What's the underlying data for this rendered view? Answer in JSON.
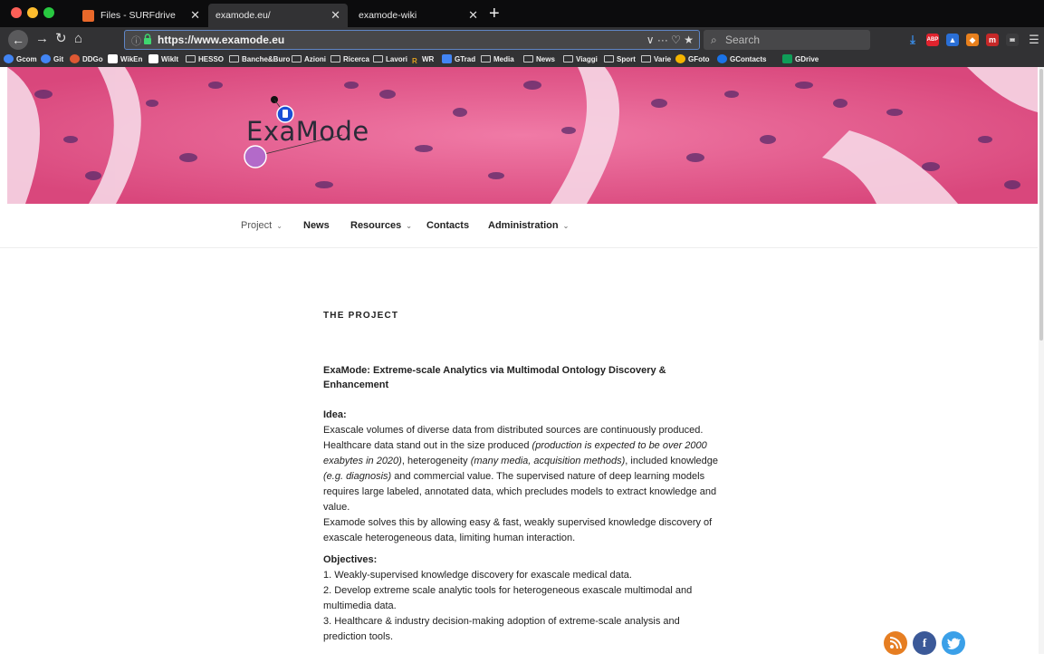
{
  "browser": {
    "tabs": [
      {
        "label": "Files - SURFdrive"
      },
      {
        "label": "examode.eu/"
      },
      {
        "label": "examode-wiki"
      }
    ],
    "url": "https://www.examode.eu",
    "url_tools": "∨  ···  ♡  ★",
    "search_placeholder": "Search",
    "bookmarks": [
      "Gcom",
      "Git",
      "DDGo",
      "WikEn",
      "WikIt",
      "HESSO",
      "Banche&Buro",
      "Azioni",
      "Ricerca",
      "Lavori",
      "WR",
      "GTrad",
      "Media",
      "News",
      "Viaggi",
      "Sport",
      "Varie",
      "GFoto",
      "GContacts",
      "GDrive"
    ]
  },
  "site": {
    "logo": "ExaMode",
    "nav": [
      {
        "label": "Project",
        "dropdown": true
      },
      {
        "label": "News",
        "dropdown": false
      },
      {
        "label": "Resources",
        "dropdown": true
      },
      {
        "label": "Contacts",
        "dropdown": false
      },
      {
        "label": "Administration",
        "dropdown": true
      }
    ],
    "section_title": "THE PROJECT",
    "headline": "ExaMode: Extreme-scale Analytics via Multimodal Ontology Discovery & Enhancement",
    "idea": {
      "heading": "Idea:",
      "p1_a": "Exascale volumes of diverse data from distributed sources are continuously produced. Healthcare data stand out in the size produced ",
      "p1_i1": "(production is expected to be over 2000 exabytes in 2020)",
      "p1_b": ", heterogeneity ",
      "p1_i2": "(many media, acquisition methods)",
      "p1_c": ", included knowledge ",
      "p1_i3": "(e.g. diagnosis)",
      "p1_d": " and commercial value. The supervised nature of deep learning models requires large labeled, annotated data, which precludes models to extract knowledge and value.",
      "p2": "Examode solves this by allowing easy & fast, weakly supervised knowledge discovery of exascale heterogeneous data, limiting human interaction."
    },
    "objectives": {
      "heading": "Objectives:",
      "items": [
        "1. Weakly-supervised knowledge discovery for exascale medical data.",
        "2. Develop extreme scale analytic tools for heterogeneous exascale multimodal and multimedia data.",
        "3. Healthcare & industry decision-making adoption of extreme-scale analysis and prediction tools."
      ]
    },
    "social": [
      {
        "name": "rss",
        "glyph": "Ω"
      },
      {
        "name": "facebook",
        "glyph": "f"
      },
      {
        "name": "twitter",
        "glyph": "t"
      }
    ]
  },
  "colors": {
    "chrome_dark": "#0c0c0d",
    "chrome": "#323234",
    "hero_pink": "#e05f8e",
    "rss": "#e67e22",
    "facebook": "#3b5998",
    "twitter": "#3ba0e8"
  }
}
